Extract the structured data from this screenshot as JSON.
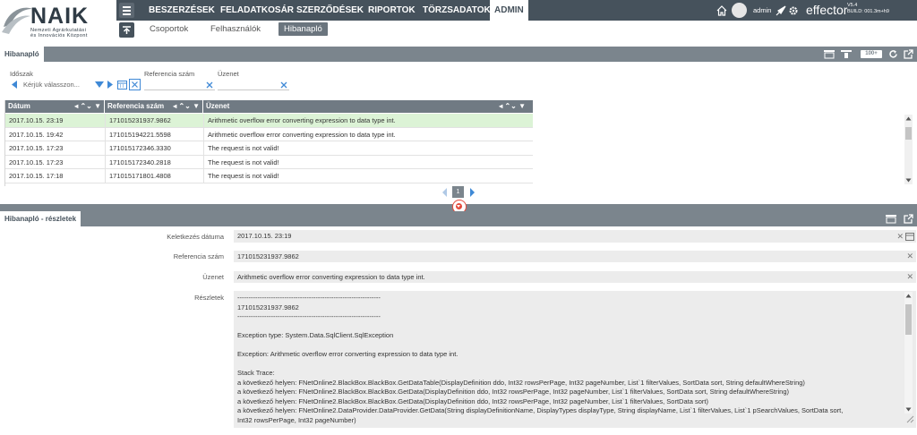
{
  "logo": {
    "main": "NAIK",
    "sub1": "Nemzeti Agrárkutatási",
    "sub2": "és Innovációs Központ"
  },
  "nav": {
    "items": [
      {
        "label": "BESZERZÉSEK"
      },
      {
        "label": "FELADATKOSÁR"
      },
      {
        "label": "SZERZŐDÉSEK"
      },
      {
        "label": "RIPORTOK"
      },
      {
        "label": "TÖRZSADATOK"
      },
      {
        "label": "ADMIN"
      }
    ],
    "active": "ADMIN",
    "sub_items": [
      {
        "label": "Csoportok"
      },
      {
        "label": "Felhasználók"
      },
      {
        "label": "Hibanapló"
      }
    ],
    "sub_active": "Hibanapló"
  },
  "user": {
    "name": "admin",
    "brand": "effector",
    "version": "V5.4",
    "build": "BUILD: 001.3m+h9"
  },
  "log_panel": {
    "title": "Hibanapló",
    "page_size_button": "100+",
    "filters": {
      "period_label": "Időszak",
      "period_placeholder": "Kérjük válasszon...",
      "reference_label": "Referencia szám",
      "message_label": "Üzenet"
    },
    "columns": [
      "Dátum",
      "Referencia szám",
      "Üzenet"
    ],
    "rows": [
      {
        "date": "2017.10.15. 23:19",
        "ref": "171015231937.9862",
        "message": "Arithmetic overflow error converting expression to data type int."
      },
      {
        "date": "2017.10.15. 19:42",
        "ref": "171015194221.5598",
        "message": "Arithmetic overflow error converting expression to data type int."
      },
      {
        "date": "2017.10.15. 17:23",
        "ref": "171015172346.3330",
        "message": "The request is not valid!"
      },
      {
        "date": "2017.10.15. 17:23",
        "ref": "171015172340.2818",
        "message": "The request is not valid!"
      },
      {
        "date": "2017.10.15. 17:18",
        "ref": "171015171801.4808",
        "message": "The request is not valid!"
      }
    ],
    "current_page": "1"
  },
  "detail_panel": {
    "title": "Hibanapló - részletek",
    "created_label": "Keletkezés dátuma",
    "created_value": "2017.10.15. 23:19",
    "reference_label": "Referencia szám",
    "reference_value": "171015231937.9862",
    "message_label": "Üzenet",
    "message_value": "Arithmetic overflow error converting expression to data type int.",
    "details_label": "Részletek",
    "details_lines": [
      "----------------------------------------------------------------",
      "171015231937.9862",
      "----------------------------------------------------------------",
      "",
      "Exception type: System.Data.SqlClient.SqlException",
      "",
      "Exception: Arithmetic overflow error converting expression to data type int.",
      "",
      "Stack Trace:",
      "   a következő helyen: FNetOnline2.BlackBox.BlackBox.GetDataTable(DisplayDefinition ddo, Int32 rowsPerPage, Int32 pageNumber, List`1 filterValues, SortData sort, String defaultWhereString)",
      "   a következő helyen: FNetOnline2.BlackBox.BlackBox.GetData(DisplayDefinition ddo, Int32 rowsPerPage, Int32 pageNumber, List`1 filterValues, SortData sort, String defaultWhereString)",
      "   a következő helyen: FNetOnline2.BlackBox.BlackBox.GetData(DisplayDefinition ddo, Int32 rowsPerPage, Int32 pageNumber, List`1 filterValues, SortData sort)",
      "   a következő helyen: FNetOnline2.DataProvider.DataProvider.GetData(String displayDefinitionName, DisplayTypes displayType, String displayName, List`1 filterValues, List`1 pSearchValues, SortData sort,",
      "Int32 rowsPerPage, Int32 pageNumber)"
    ]
  },
  "colors": {
    "navbar": "#46525c",
    "panel_header": "#7b858d",
    "selected_row": "#dcf3d6",
    "accent": "#3f89d6",
    "toggle": "#e54b3c"
  }
}
